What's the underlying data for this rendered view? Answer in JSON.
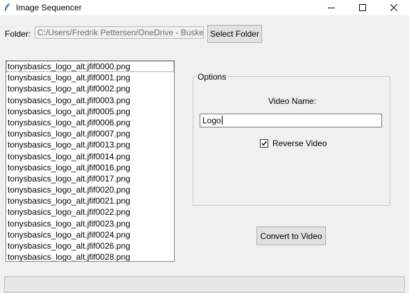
{
  "window": {
    "title": "Image Sequencer",
    "controls": [
      "minimize-icon",
      "maximize-icon",
      "close-icon"
    ]
  },
  "folder": {
    "label": "Folder:",
    "path": "C:/Users/Fredrik Pettersen/OneDrive - Buskeru",
    "button_label": "Select Folder"
  },
  "file_list": {
    "items": [
      "tonysbasics_logo_alt.jfif0000.png",
      "tonysbasics_logo_alt.jfif0001.png",
      "tonysbasics_logo_alt.jfif0002.png",
      "tonysbasics_logo_alt.jfif0003.png",
      "tonysbasics_logo_alt.jfif0005.png",
      "tonysbasics_logo_alt.jfif0006.png",
      "tonysbasics_logo_alt.jfif0007.png",
      "tonysbasics_logo_alt.jfif0013.png",
      "tonysbasics_logo_alt.jfif0014.png",
      "tonysbasics_logo_alt.jfif0016.png",
      "tonysbasics_logo_alt.jfif0017.png",
      "tonysbasics_logo_alt.jfif0020.png",
      "tonysbasics_logo_alt.jfif0021.png",
      "tonysbasics_logo_alt.jfif0022.png",
      "tonysbasics_logo_alt.jfif0023.png",
      "tonysbasics_logo_alt.jfif0024.png",
      "tonysbasics_logo_alt.jfif0026.png",
      "tonysbasics_logo_alt.jfif0028.png"
    ]
  },
  "options": {
    "legend": "Options",
    "video_name_label": "Video Name:",
    "video_name_value": "Logo",
    "reverse_label": "Reverse Video",
    "reverse_checked": true
  },
  "actions": {
    "convert_label": "Convert to Video"
  },
  "icons": {
    "app": "feather-icon",
    "checkbox": "checkmark-icon"
  }
}
